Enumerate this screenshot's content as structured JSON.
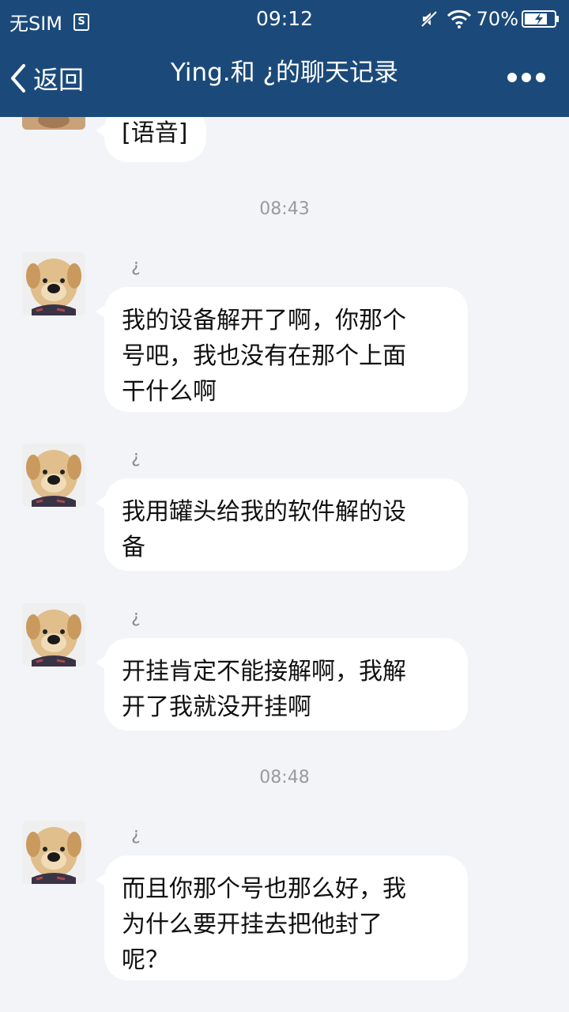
{
  "status_bar": {
    "carrier": "无SIM",
    "sim_icon": "S",
    "time": "09:12",
    "battery": "70%"
  },
  "nav": {
    "back_label": "返回",
    "title": "Ying.和 ¿的聊天记录"
  },
  "colors": {
    "appbar": "#1b4a7a",
    "chat_bg": "#f3f4f8",
    "bubble": "#ffffff",
    "timestamp": "#9a9a9a"
  },
  "messages": {
    "m0": {
      "text": "[语音]"
    },
    "t1": "08:43",
    "m1": {
      "sender": "¿",
      "text": "我的设备解开了啊，你那个\n号吧，我也没有在那个上面\n干什么啊"
    },
    "m2": {
      "sender": "¿",
      "text": "我用罐头给我的软件解的设\n备"
    },
    "m3": {
      "sender": "¿",
      "text": "开挂肯定不能接解啊，我解\n开了我就没开挂啊"
    },
    "t2": "08:48",
    "m4": {
      "sender": "¿",
      "text": "而且你那个号也那么好，我\n为什么要开挂去把他封了\n呢？"
    }
  }
}
